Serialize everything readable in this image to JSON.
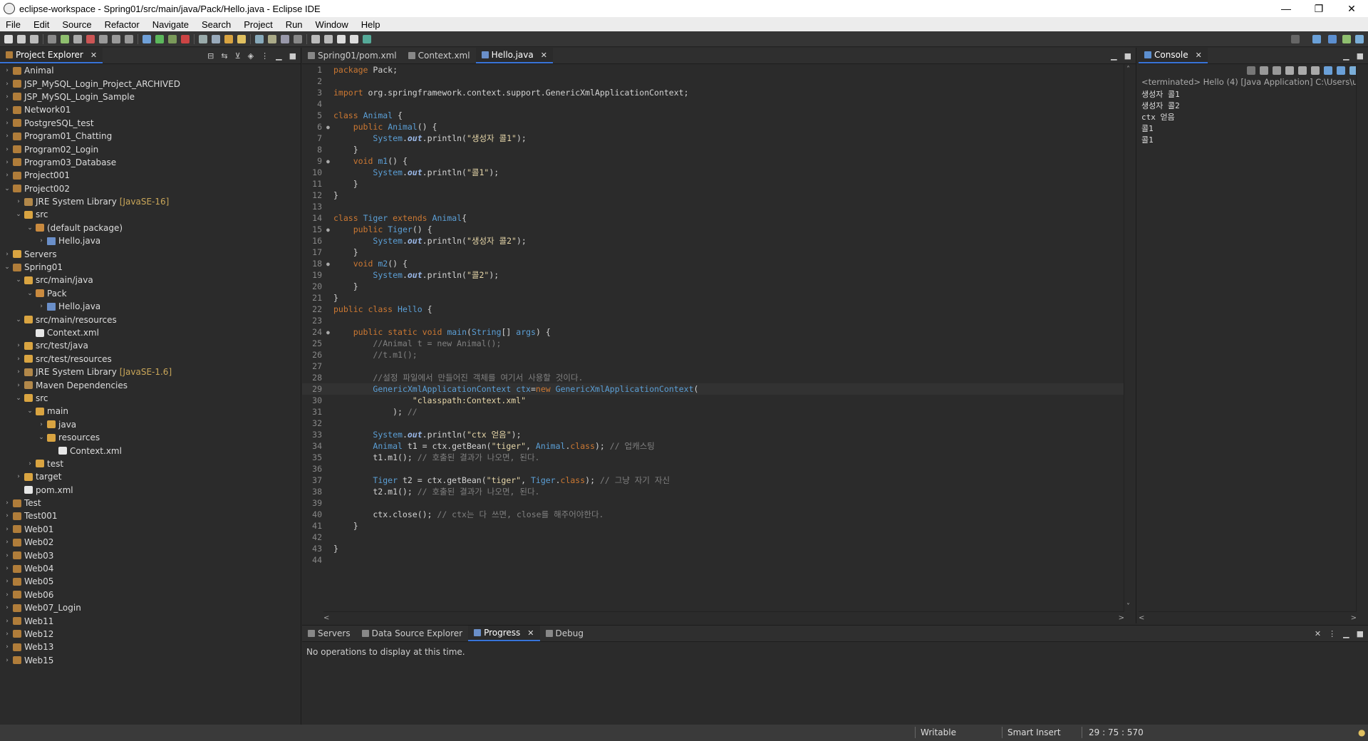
{
  "window": {
    "title": "eclipse-workspace - Spring01/src/main/java/Pack/Hello.java - Eclipse IDE",
    "minimize": "—",
    "maximize": "❐",
    "close": "✕"
  },
  "menu": [
    "File",
    "Edit",
    "Source",
    "Refactor",
    "Navigate",
    "Search",
    "Project",
    "Run",
    "Window",
    "Help"
  ],
  "explorer": {
    "tab": "Project Explorer",
    "close": "✕",
    "nodes": [
      {
        "label": "Animal",
        "indent": 0,
        "arrow": "›",
        "icon": "project"
      },
      {
        "label": "JSP_MySQL_Login_Project_ARCHIVED",
        "indent": 0,
        "arrow": "›",
        "icon": "project"
      },
      {
        "label": "JSP_MySQL_Login_Sample",
        "indent": 0,
        "arrow": "›",
        "icon": "project"
      },
      {
        "label": "Network01",
        "indent": 0,
        "arrow": "›",
        "icon": "project"
      },
      {
        "label": "PostgreSQL_test",
        "indent": 0,
        "arrow": "›",
        "icon": "project"
      },
      {
        "label": "Program01_Chatting",
        "indent": 0,
        "arrow": "›",
        "icon": "project"
      },
      {
        "label": "Program02_Login",
        "indent": 0,
        "arrow": "›",
        "icon": "project"
      },
      {
        "label": "Program03_Database",
        "indent": 0,
        "arrow": "›",
        "icon": "project"
      },
      {
        "label": "Project001",
        "indent": 0,
        "arrow": "›",
        "icon": "project"
      },
      {
        "label": "Project002",
        "indent": 0,
        "arrow": "⌄",
        "icon": "project"
      },
      {
        "label": "JRE System Library",
        "deco": "[JavaSE-16]",
        "indent": 1,
        "arrow": "›",
        "icon": "lib"
      },
      {
        "label": "src",
        "indent": 1,
        "arrow": "⌄",
        "icon": "folder"
      },
      {
        "label": "(default package)",
        "indent": 2,
        "arrow": "⌄",
        "icon": "pkg"
      },
      {
        "label": "Hello.java",
        "indent": 3,
        "arrow": "›",
        "icon": "java"
      },
      {
        "label": "Servers",
        "indent": 0,
        "arrow": "›",
        "icon": "folder"
      },
      {
        "label": "Spring01",
        "indent": 0,
        "arrow": "⌄",
        "icon": "project"
      },
      {
        "label": "src/main/java",
        "indent": 1,
        "arrow": "⌄",
        "icon": "folder"
      },
      {
        "label": "Pack",
        "indent": 2,
        "arrow": "⌄",
        "icon": "pkg"
      },
      {
        "label": "Hello.java",
        "indent": 3,
        "arrow": "›",
        "icon": "java"
      },
      {
        "label": "src/main/resources",
        "indent": 1,
        "arrow": "⌄",
        "icon": "folder"
      },
      {
        "label": "Context.xml",
        "indent": 2,
        "arrow": "",
        "icon": "xml"
      },
      {
        "label": "src/test/java",
        "indent": 1,
        "arrow": "›",
        "icon": "folder"
      },
      {
        "label": "src/test/resources",
        "indent": 1,
        "arrow": "›",
        "icon": "folder"
      },
      {
        "label": "JRE System Library",
        "deco": "[JavaSE-1.6]",
        "indent": 1,
        "arrow": "›",
        "icon": "lib"
      },
      {
        "label": "Maven Dependencies",
        "indent": 1,
        "arrow": "›",
        "icon": "lib"
      },
      {
        "label": "src",
        "indent": 1,
        "arrow": "⌄",
        "icon": "folder"
      },
      {
        "label": "main",
        "indent": 2,
        "arrow": "⌄",
        "icon": "folder"
      },
      {
        "label": "java",
        "indent": 3,
        "arrow": "›",
        "icon": "folder"
      },
      {
        "label": "resources",
        "indent": 3,
        "arrow": "⌄",
        "icon": "folder"
      },
      {
        "label": "Context.xml",
        "indent": 4,
        "arrow": "",
        "icon": "xml"
      },
      {
        "label": "test",
        "indent": 2,
        "arrow": "›",
        "icon": "folder"
      },
      {
        "label": "target",
        "indent": 1,
        "arrow": "›",
        "icon": "folder"
      },
      {
        "label": "pom.xml",
        "indent": 1,
        "arrow": "",
        "icon": "xml"
      },
      {
        "label": "Test",
        "indent": 0,
        "arrow": "›",
        "icon": "project"
      },
      {
        "label": "Test001",
        "indent": 0,
        "arrow": "›",
        "icon": "project"
      },
      {
        "label": "Web01",
        "indent": 0,
        "arrow": "›",
        "icon": "project"
      },
      {
        "label": "Web02",
        "indent": 0,
        "arrow": "›",
        "icon": "project"
      },
      {
        "label": "Web03",
        "indent": 0,
        "arrow": "›",
        "icon": "project"
      },
      {
        "label": "Web04",
        "indent": 0,
        "arrow": "›",
        "icon": "project"
      },
      {
        "label": "Web05",
        "indent": 0,
        "arrow": "›",
        "icon": "project"
      },
      {
        "label": "Web06",
        "indent": 0,
        "arrow": "›",
        "icon": "project"
      },
      {
        "label": "Web07_Login",
        "indent": 0,
        "arrow": "›",
        "icon": "project"
      },
      {
        "label": "Web11",
        "indent": 0,
        "arrow": "›",
        "icon": "project"
      },
      {
        "label": "Web12",
        "indent": 0,
        "arrow": "›",
        "icon": "project"
      },
      {
        "label": "Web13",
        "indent": 0,
        "arrow": "›",
        "icon": "project"
      },
      {
        "label": "Web15",
        "indent": 0,
        "arrow": "›",
        "icon": "project"
      }
    ]
  },
  "editor": {
    "tabs": [
      {
        "label": "Spring01/pom.xml",
        "active": false,
        "close": ""
      },
      {
        "label": "Context.xml",
        "active": false,
        "close": ""
      },
      {
        "label": "Hello.java",
        "active": true,
        "close": "✕"
      }
    ],
    "current_line": 29,
    "lines": [
      {
        "n": 1,
        "m": "",
        "t": [
          [
            "kw",
            "package"
          ],
          [
            "tx",
            " Pack;"
          ]
        ]
      },
      {
        "n": 2,
        "m": "",
        "t": []
      },
      {
        "n": 3,
        "m": "",
        "t": [
          [
            "kw",
            "import"
          ],
          [
            "tx",
            " org.springframework.context.support.GenericXmlApplicationContext;"
          ]
        ]
      },
      {
        "n": 4,
        "m": "",
        "t": []
      },
      {
        "n": 5,
        "m": "",
        "t": [
          [
            "kw",
            "class"
          ],
          [
            "tx",
            " "
          ],
          [
            "ty",
            "Animal"
          ],
          [
            "tx",
            " {"
          ]
        ]
      },
      {
        "n": 6,
        "m": "●",
        "t": [
          [
            "tx",
            "    "
          ],
          [
            "kw",
            "public"
          ],
          [
            "tx",
            " "
          ],
          [
            "ty",
            "Animal"
          ],
          [
            "tx",
            "() {"
          ]
        ]
      },
      {
        "n": 7,
        "m": "",
        "t": [
          [
            "tx",
            "        "
          ],
          [
            "ty",
            "System"
          ],
          [
            "tx",
            "."
          ],
          [
            "fi",
            "out"
          ],
          [
            "tx",
            ".println("
          ],
          [
            "st",
            "\"생성자 콜1\""
          ],
          [
            "tx",
            ");"
          ]
        ]
      },
      {
        "n": 8,
        "m": "",
        "t": [
          [
            "tx",
            "    }"
          ]
        ]
      },
      {
        "n": 9,
        "m": "●",
        "t": [
          [
            "tx",
            "    "
          ],
          [
            "kw",
            "void"
          ],
          [
            "tx",
            " "
          ],
          [
            "ty",
            "m1"
          ],
          [
            "tx",
            "() {"
          ]
        ]
      },
      {
        "n": 10,
        "m": "",
        "t": [
          [
            "tx",
            "        "
          ],
          [
            "ty",
            "System"
          ],
          [
            "tx",
            "."
          ],
          [
            "fi",
            "out"
          ],
          [
            "tx",
            ".println("
          ],
          [
            "st",
            "\"콜1\""
          ],
          [
            "tx",
            ");"
          ]
        ]
      },
      {
        "n": 11,
        "m": "",
        "t": [
          [
            "tx",
            "    }"
          ]
        ]
      },
      {
        "n": 12,
        "m": "",
        "t": [
          [
            "tx",
            "}"
          ]
        ]
      },
      {
        "n": 13,
        "m": "",
        "t": []
      },
      {
        "n": 14,
        "m": "",
        "t": [
          [
            "kw",
            "class"
          ],
          [
            "tx",
            " "
          ],
          [
            "ty",
            "Tiger"
          ],
          [
            "tx",
            " "
          ],
          [
            "kw",
            "extends"
          ],
          [
            "tx",
            " "
          ],
          [
            "ty",
            "Animal"
          ],
          [
            "tx",
            "{"
          ]
        ]
      },
      {
        "n": 15,
        "m": "●",
        "t": [
          [
            "tx",
            "    "
          ],
          [
            "kw",
            "public"
          ],
          [
            "tx",
            " "
          ],
          [
            "ty",
            "Tiger"
          ],
          [
            "tx",
            "() {"
          ]
        ]
      },
      {
        "n": 16,
        "m": "",
        "t": [
          [
            "tx",
            "        "
          ],
          [
            "ty",
            "System"
          ],
          [
            "tx",
            "."
          ],
          [
            "fi",
            "out"
          ],
          [
            "tx",
            ".println("
          ],
          [
            "st",
            "\"생성자 콜2\""
          ],
          [
            "tx",
            ");"
          ]
        ]
      },
      {
        "n": 17,
        "m": "",
        "t": [
          [
            "tx",
            "    }"
          ]
        ]
      },
      {
        "n": 18,
        "m": "●",
        "t": [
          [
            "tx",
            "    "
          ],
          [
            "kw",
            "void"
          ],
          [
            "tx",
            " "
          ],
          [
            "ty",
            "m2"
          ],
          [
            "tx",
            "() {"
          ]
        ]
      },
      {
        "n": 19,
        "m": "",
        "t": [
          [
            "tx",
            "        "
          ],
          [
            "ty",
            "System"
          ],
          [
            "tx",
            "."
          ],
          [
            "fi",
            "out"
          ],
          [
            "tx",
            ".println("
          ],
          [
            "st",
            "\"콜2\""
          ],
          [
            "tx",
            ");"
          ]
        ]
      },
      {
        "n": 20,
        "m": "",
        "t": [
          [
            "tx",
            "    }"
          ]
        ]
      },
      {
        "n": 21,
        "m": "",
        "t": [
          [
            "tx",
            "}"
          ]
        ]
      },
      {
        "n": 22,
        "m": "",
        "t": [
          [
            "kw",
            "public"
          ],
          [
            "tx",
            " "
          ],
          [
            "kw",
            "class"
          ],
          [
            "tx",
            " "
          ],
          [
            "ty",
            "Hello"
          ],
          [
            "tx",
            " {"
          ]
        ]
      },
      {
        "n": 23,
        "m": "",
        "t": []
      },
      {
        "n": 24,
        "m": "●",
        "t": [
          [
            "tx",
            "    "
          ],
          [
            "kw",
            "public"
          ],
          [
            "tx",
            " "
          ],
          [
            "kw",
            "static"
          ],
          [
            "tx",
            " "
          ],
          [
            "kw",
            "void"
          ],
          [
            "tx",
            " "
          ],
          [
            "ty",
            "main"
          ],
          [
            "tx",
            "("
          ],
          [
            "ty",
            "String"
          ],
          [
            "tx",
            "[] "
          ],
          [
            "ty",
            "args"
          ],
          [
            "tx",
            ") {"
          ]
        ]
      },
      {
        "n": 25,
        "m": "",
        "t": [
          [
            "cm",
            "        //Animal t = new Animal();"
          ]
        ]
      },
      {
        "n": 26,
        "m": "",
        "t": [
          [
            "cm",
            "        //t.m1();"
          ]
        ]
      },
      {
        "n": 27,
        "m": "",
        "t": []
      },
      {
        "n": 28,
        "m": "",
        "t": [
          [
            "cm",
            "        //설정 파일에서 만들어진 객체를 여기서 사용할 것이다."
          ]
        ]
      },
      {
        "n": 29,
        "m": "",
        "t": [
          [
            "tx",
            "        "
          ],
          [
            "ty",
            "GenericXmlApplicationContext"
          ],
          [
            "tx",
            " "
          ],
          [
            "ty",
            "ctx"
          ],
          [
            "tx",
            "="
          ],
          [
            "kw",
            "new"
          ],
          [
            "tx",
            " "
          ],
          [
            "ty",
            "GenericXmlApplicationContext"
          ],
          [
            "tx",
            "("
          ]
        ]
      },
      {
        "n": 30,
        "m": "",
        "t": [
          [
            "tx",
            "                "
          ],
          [
            "st",
            "\"classpath:Context.xml\""
          ]
        ]
      },
      {
        "n": 31,
        "m": "",
        "t": [
          [
            "tx",
            "            ); "
          ],
          [
            "cm",
            "//"
          ]
        ]
      },
      {
        "n": 32,
        "m": "",
        "t": []
      },
      {
        "n": 33,
        "m": "",
        "t": [
          [
            "tx",
            "        "
          ],
          [
            "ty",
            "System"
          ],
          [
            "tx",
            "."
          ],
          [
            "fi",
            "out"
          ],
          [
            "tx",
            ".println("
          ],
          [
            "st",
            "\"ctx 얻음\""
          ],
          [
            "tx",
            ");"
          ]
        ]
      },
      {
        "n": 34,
        "m": "",
        "t": [
          [
            "tx",
            "        "
          ],
          [
            "ty",
            "Animal"
          ],
          [
            "tx",
            " t1 = ctx.getBean("
          ],
          [
            "st",
            "\"tiger\""
          ],
          [
            "tx",
            ", "
          ],
          [
            "ty",
            "Animal"
          ],
          [
            "tx",
            "."
          ],
          [
            "kw",
            "class"
          ],
          [
            "tx",
            "); "
          ],
          [
            "cm",
            "// 업캐스팅"
          ]
        ]
      },
      {
        "n": 35,
        "m": "",
        "t": [
          [
            "tx",
            "        t1.m1(); "
          ],
          [
            "cm",
            "// 호출된 결과가 나오면, 된다."
          ]
        ]
      },
      {
        "n": 36,
        "m": "",
        "t": []
      },
      {
        "n": 37,
        "m": "",
        "t": [
          [
            "tx",
            "        "
          ],
          [
            "ty",
            "Tiger"
          ],
          [
            "tx",
            " t2 = ctx.getBean("
          ],
          [
            "st",
            "\"tiger\""
          ],
          [
            "tx",
            ", "
          ],
          [
            "ty",
            "Tiger"
          ],
          [
            "tx",
            "."
          ],
          [
            "kw",
            "class"
          ],
          [
            "tx",
            "); "
          ],
          [
            "cm",
            "// 그냥 자기 자신"
          ]
        ]
      },
      {
        "n": 38,
        "m": "",
        "t": [
          [
            "tx",
            "        t2.m1(); "
          ],
          [
            "cm",
            "// 호출된 결과가 나오면, 된다."
          ]
        ]
      },
      {
        "n": 39,
        "m": "",
        "t": []
      },
      {
        "n": 40,
        "m": "",
        "t": [
          [
            "tx",
            "        ctx.close(); "
          ],
          [
            "cm",
            "// ctx는 다 쓰면, close를 해주어야한다."
          ]
        ]
      },
      {
        "n": 41,
        "m": "",
        "t": [
          [
            "tx",
            "    }"
          ]
        ]
      },
      {
        "n": 42,
        "m": "",
        "t": []
      },
      {
        "n": 43,
        "m": "",
        "t": [
          [
            "tx",
            "}"
          ]
        ]
      },
      {
        "n": 44,
        "m": "",
        "t": []
      }
    ],
    "scroll_left": "<",
    "scroll_right": ">",
    "scroll_up": "˄",
    "scroll_down": "˅"
  },
  "console": {
    "tab": "Console",
    "close": "✕",
    "title": "<terminated> Hello (4) [Java Application] C:\\Users\\user",
    "output": [
      "생성자 콜1",
      "생성자 콜2",
      "ctx 얻음",
      "콜1",
      "콜1"
    ],
    "scroll_left": "<",
    "scroll_right": ">"
  },
  "bottom": {
    "tabs": [
      {
        "label": "Servers",
        "active": false,
        "close": ""
      },
      {
        "label": "Data Source Explorer",
        "active": false,
        "close": ""
      },
      {
        "label": "Progress",
        "active": true,
        "close": "✕"
      },
      {
        "label": "Debug",
        "active": false,
        "close": ""
      }
    ],
    "message": "No operations to display at this time."
  },
  "status": {
    "mode": "Writable",
    "insert": "Smart Insert",
    "position": "29 : 75 : 570"
  },
  "colors": {
    "accent": "#3874d8",
    "keyword": "#cc7832",
    "type": "#5b9fd6",
    "string": "#e6d6a8",
    "comment": "#808080"
  }
}
